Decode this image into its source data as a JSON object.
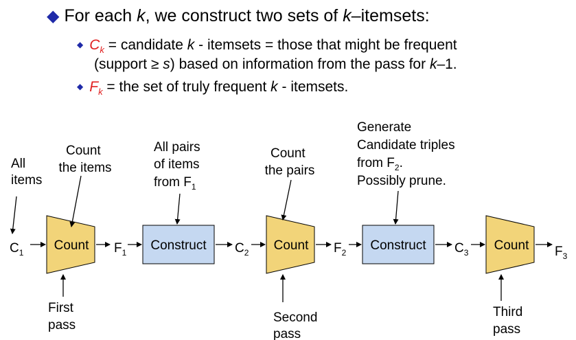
{
  "bullets": {
    "main_pre": "For each",
    "main_var": "k",
    "main_post": ", we construct two sets of",
    "main_var2": "k",
    "main_end": "–itemsets:",
    "sub1_sym": "C",
    "sub1_sym_sub": "k",
    "sub1_a": " = candidate",
    "sub1_var": "k",
    "sub1_b": "- itemsets = those that might be frequent",
    "sub1_line2_a": "(support ≥",
    "sub1_line2_var": "s",
    "sub1_line2_b": ") based on information from the pass for",
    "sub1_line2_var2": "k",
    "sub1_line2_end": "–1.",
    "sub2_sym": "F",
    "sub2_sym_sub": "k",
    "sub2_a": " = the set of truly frequent",
    "sub2_var": "k",
    "sub2_b": "- itemsets."
  },
  "diagram": {
    "colors": {
      "count_fill": "#f2d479",
      "construct_fill": "#c5d8f1",
      "stroke": "#000000"
    },
    "flow_labels": {
      "c1": "C",
      "c1_sub": "1",
      "f1": "F",
      "f1_sub": "1",
      "c2": "C",
      "c2_sub": "2",
      "f2": "F",
      "f2_sub": "2",
      "c3": "C",
      "c3_sub": "3",
      "f3": "F",
      "f3_sub": "3"
    },
    "count1": "Count",
    "construct1": "Construct",
    "count2": "Count",
    "construct2": "Construct",
    "count3": "Count",
    "ann_all_items": [
      "All",
      "items"
    ],
    "ann_count_items": [
      "Count",
      "the items"
    ],
    "ann_all_pairs": [
      "All pairs",
      "of items",
      "from F"
    ],
    "ann_all_pairs_sub": "1",
    "ann_count_pairs": [
      "Count",
      "the pairs"
    ],
    "ann_generate": [
      "Generate",
      "Candidate triples",
      "from F",
      "Possibly prune."
    ],
    "ann_generate_sub": "2",
    "ann_generate_dot": ".",
    "pass1": [
      "First",
      "pass"
    ],
    "pass2": [
      "Second",
      "pass"
    ],
    "pass3": [
      "Third",
      "pass"
    ]
  }
}
